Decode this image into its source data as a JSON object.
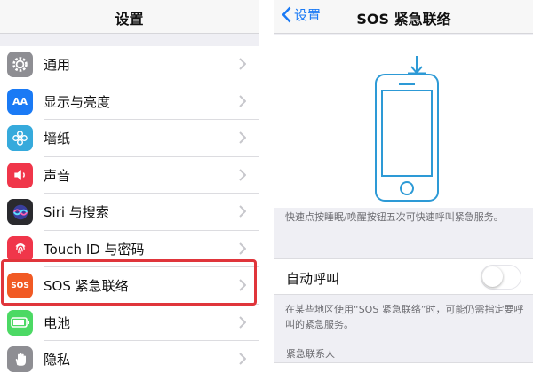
{
  "left_screen": {
    "title": "设置",
    "items": [
      {
        "label": "通用",
        "icon": "gear-icon",
        "color": "#8e8e93"
      },
      {
        "label": "显示与亮度",
        "icon": "text-size-icon",
        "icon_text": "AA",
        "color": "#1a7af5"
      },
      {
        "label": "墙纸",
        "icon": "flower-icon",
        "color": "#36aadc"
      },
      {
        "label": "声音",
        "icon": "speaker-icon",
        "color": "#f0364a"
      },
      {
        "label": "Siri 与搜索",
        "icon": "siri-icon",
        "color": "#2a2a2e"
      },
      {
        "label": "Touch ID 与密码",
        "icon": "fingerprint-icon",
        "color": "#f0364a"
      },
      {
        "label": "SOS 紧急联络",
        "icon": "sos-icon",
        "icon_text": "SOS",
        "color": "#f15a24",
        "highlighted": true
      },
      {
        "label": "电池",
        "icon": "battery-icon",
        "color": "#4cd964"
      },
      {
        "label": "隐私",
        "icon": "hand-icon",
        "color": "#8e8e93"
      }
    ],
    "highlight_color": "#e0353b"
  },
  "right_screen": {
    "back_label": "设置",
    "title": "SOS 紧急联络",
    "illustration_color": "#2d9ad6",
    "description": "快速点按睡眠/唤醒按钮五次可快速呼叫紧急服务。",
    "auto_call_label": "自动呼叫",
    "auto_call_on": false,
    "auto_call_note": "在某些地区使用“SOS 紧急联络”时，可能仍需指定要呼叫的紧急服务。",
    "emergency_contacts_header": "紧急联系人"
  }
}
